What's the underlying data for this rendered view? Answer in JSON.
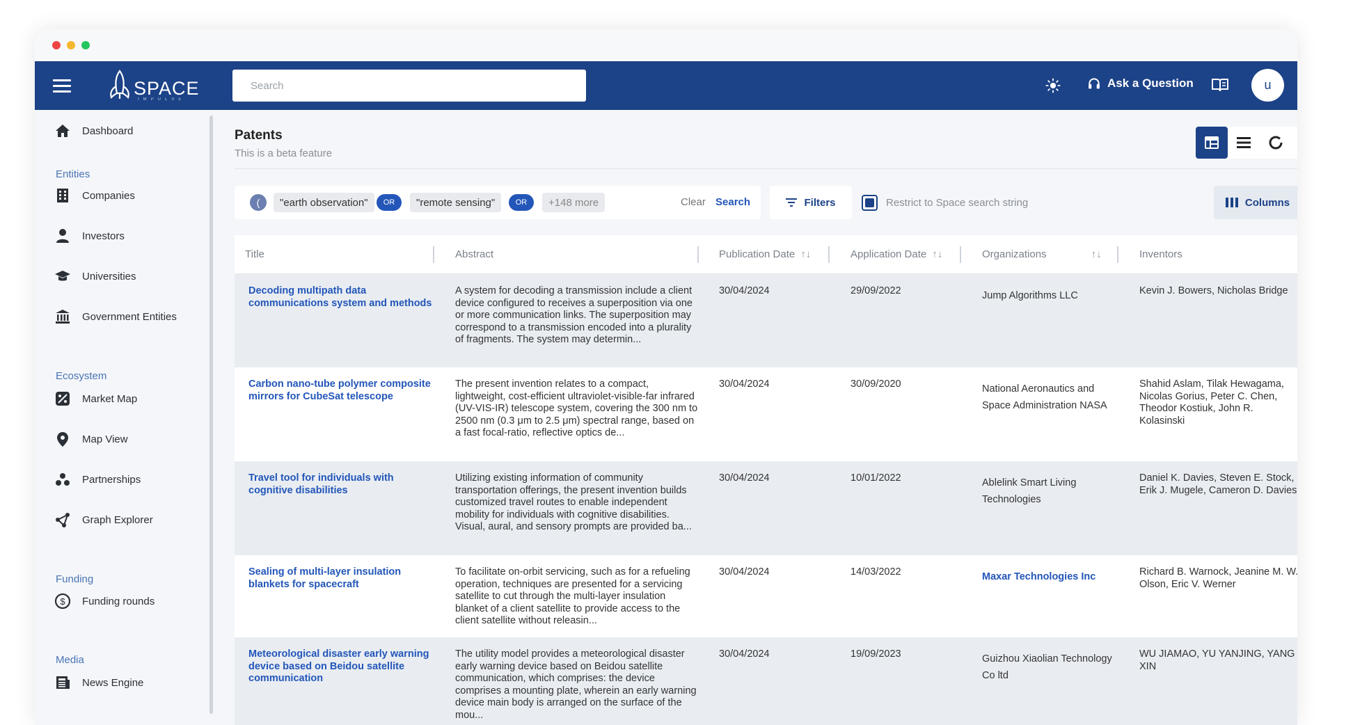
{
  "header": {
    "logo_text": "SPACE",
    "logo_sub": "IMPULSE",
    "search_placeholder": "Search",
    "ask_label": "Ask a Question",
    "avatar_initial": "u",
    "brand_color": "#1c4287"
  },
  "sidebar": {
    "dashboard": "Dashboard",
    "sections": {
      "entities": "Entities",
      "ecosystem": "Ecosystem",
      "funding": "Funding",
      "media": "Media"
    },
    "items": {
      "companies": "Companies",
      "investors": "Investors",
      "universities": "Universities",
      "government": "Government Entities",
      "market_map": "Market Map",
      "map_view": "Map View",
      "partnerships": "Partnerships",
      "graph_explorer": "Graph Explorer",
      "funding_rounds": "Funding rounds",
      "news_engine": "News Engine"
    }
  },
  "page": {
    "title": "Patents",
    "subtitle": "This is a beta feature"
  },
  "query": {
    "paren": "(",
    "term1": "\"earth observation\"",
    "op1": "OR",
    "term2": "\"remote sensing\"",
    "op2": "OR",
    "more": "+148 more",
    "clear": "Clear",
    "search": "Search"
  },
  "toolbar": {
    "filters": "Filters",
    "restrict_label": "Restrict to Space search string",
    "columns": "Columns"
  },
  "table": {
    "columns": [
      "Title",
      "Abstract",
      "Publication Date",
      "Application Date",
      "Organizations",
      "Inventors"
    ],
    "rows": [
      {
        "title": "Decoding multipath data communications system and methods",
        "abstract": "A system for decoding a transmission include a client device configured to receives a superposition via one or more communication links. The superposition may correspond to a transmission encoded into a plurality of fragments. The system may determin...",
        "pub_date": "30/04/2024",
        "app_date": "29/09/2022",
        "org": "Jump Algorithms LLC",
        "inventors": "Kevin J. Bowers, Nicholas Bridge"
      },
      {
        "title": "Carbon nano-tube polymer composite mirrors for CubeSat telescope",
        "abstract": "The present invention relates to a compact, lightweight, cost-efficient ultraviolet-visible-far infrared (UV-VIS-IR) telescope system, covering the 300 nm to 2500 nm (0.3 μm to 2.5 μm) spectral range, based on a fast focal-ratio, reflective optics de...",
        "pub_date": "30/04/2024",
        "app_date": "30/09/2020",
        "org": "National Aeronautics and Space Administration NASA",
        "inventors": "Shahid Aslam, Tilak Hewagama, Nicolas Gorius, Peter C. Chen, Theodor Kostiuk, John R. Kolasinski"
      },
      {
        "title": "Travel tool for individuals with cognitive disabilities",
        "abstract": "Utilizing existing information of community transportation offerings, the present invention builds customized travel routes to enable independent mobility for individuals with cognitive disabilities. Visual, aural, and sensory prompts are provided ba...",
        "pub_date": "30/04/2024",
        "app_date": "10/01/2022",
        "org": "Ablelink Smart Living Technologies",
        "inventors": "Daniel K. Davies, Steven E. Stock, Erik J. Mugele, Cameron D. Davies"
      },
      {
        "title": "Sealing of multi-layer insulation blankets for spacecraft",
        "abstract": "To facilitate on-orbit servicing, such as for a refueling operation, techniques are presented for a servicing satellite to cut through the multi-layer insulation blanket of a client satellite to provide access to the client satellite without releasin...",
        "pub_date": "30/04/2024",
        "app_date": "14/03/2022",
        "org": "Maxar Technologies Inc",
        "inventors": "Richard B. Warnock, Jeanine M. W. Olson, Eric V. Werner"
      },
      {
        "title": "Meteorological disaster early warning device based on Beidou satellite communication",
        "abstract": "The utility model provides a meteorological disaster early warning device based on Beidou satellite communication, which comprises: the device comprises a mounting plate, wherein an early warning device main body is arranged on the surface of the mou...",
        "pub_date": "30/04/2024",
        "app_date": "19/09/2023",
        "org": "Guizhou Xiaolian Technology Co ltd",
        "inventors": "WU JIAMAO, YU YANJING, YANG XIN"
      }
    ]
  }
}
